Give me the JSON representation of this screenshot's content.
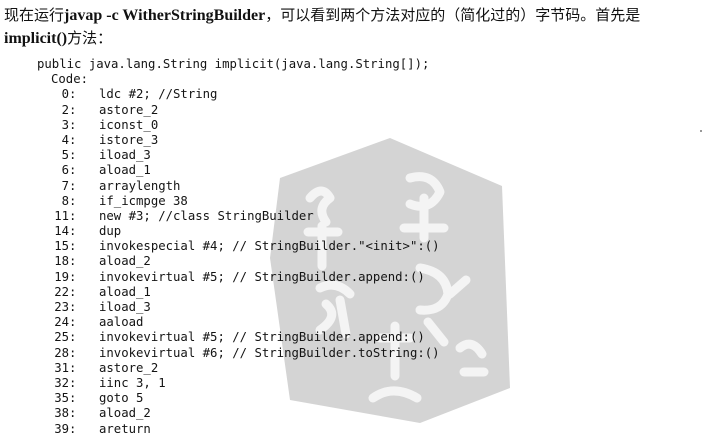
{
  "intro": {
    "part1": "现在运行",
    "cmd": "javap -c WitherStringBuilder",
    "part2": "，可以看到两个方法对应的（简化过的）字节码。首先是",
    "method": "implicit()",
    "part3": "方法："
  },
  "code": {
    "signature": "public java.lang.String implicit(java.lang.String[]);",
    "label": "Code:",
    "lines": [
      {
        "offset": "0",
        "instr": "ldc #2; //String"
      },
      {
        "offset": "2",
        "instr": "astore_2"
      },
      {
        "offset": "3",
        "instr": "iconst_0"
      },
      {
        "offset": "4",
        "instr": "istore_3"
      },
      {
        "offset": "5",
        "instr": "iload_3"
      },
      {
        "offset": "6",
        "instr": "aload_1"
      },
      {
        "offset": "7",
        "instr": "arraylength"
      },
      {
        "offset": "8",
        "instr": "if_icmpge 38"
      },
      {
        "offset": "11",
        "instr": "new #3; //class StringBuilder"
      },
      {
        "offset": "14",
        "instr": "dup"
      },
      {
        "offset": "15",
        "instr": "invokespecial #4; // StringBuilder.\"<init>\":()"
      },
      {
        "offset": "18",
        "instr": "aload_2"
      },
      {
        "offset": "19",
        "instr": "invokevirtual #5; // StringBuilder.append:()"
      },
      {
        "offset": "22",
        "instr": "aload_1"
      },
      {
        "offset": "23",
        "instr": "iload_3"
      },
      {
        "offset": "24",
        "instr": "aaload"
      },
      {
        "offset": "25",
        "instr": "invokevirtual #5; // StringBuilder.append:()"
      },
      {
        "offset": "28",
        "instr": "invokevirtual #6; // StringBuilder.toString:()"
      },
      {
        "offset": "31",
        "instr": "astore_2"
      },
      {
        "offset": "32",
        "instr": "iinc 3, 1"
      },
      {
        "offset": "35",
        "instr": "goto 5"
      },
      {
        "offset": "38",
        "instr": "aload_2"
      },
      {
        "offset": "39",
        "instr": "areturn"
      }
    ]
  },
  "watermark": {
    "fill": "#d4d4d4",
    "mark": "#f4f4f4"
  }
}
